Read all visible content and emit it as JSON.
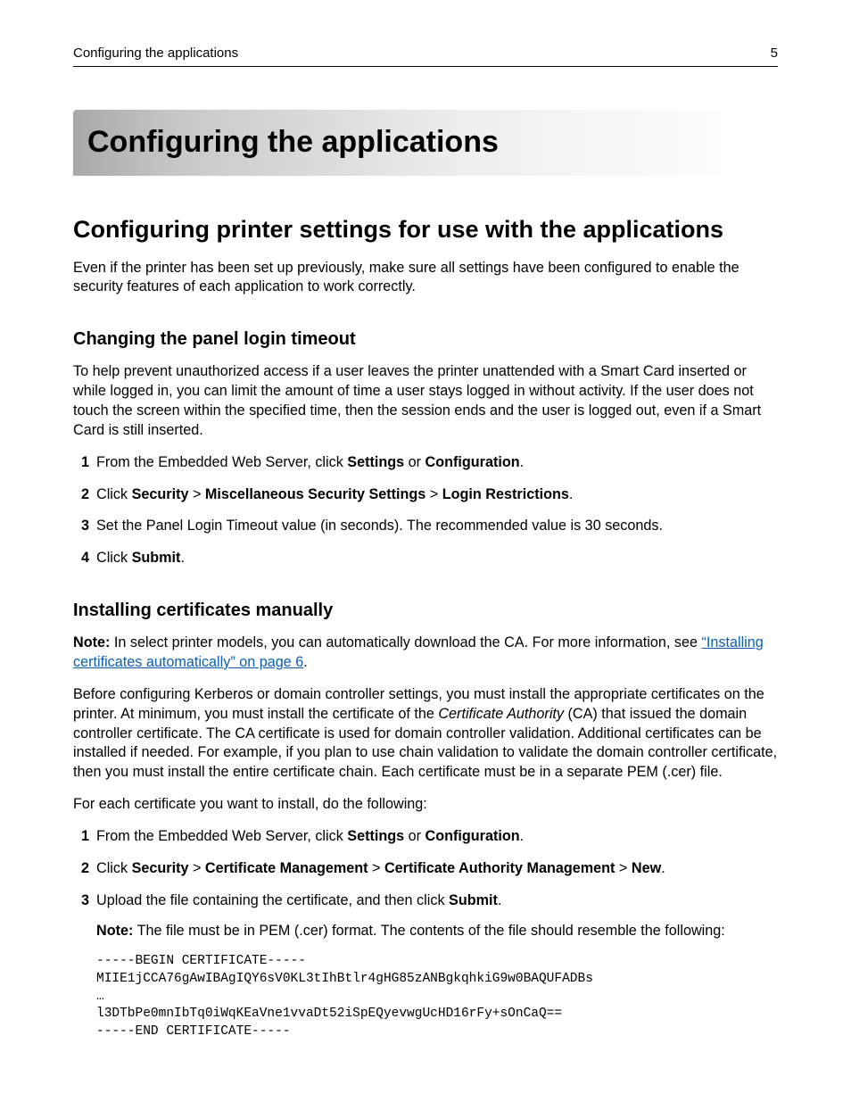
{
  "header": {
    "left": "Configuring the applications",
    "right": "5"
  },
  "chapter_title": "Configuring the applications",
  "section_title": "Configuring printer settings for use with the applications",
  "section_intro": "Even if the printer has been set up previously, make sure all settings have been configured to enable the security features of each application to work correctly.",
  "sub1": {
    "title": "Changing the panel login timeout",
    "intro": "To help prevent unauthorized access if a user leaves the printer unattended with a Smart Card inserted or while logged in, you can limit the amount of time a user stays logged in without activity. If the user does not touch the screen within the specified time, then the session ends and the user is logged out, even if a Smart Card is still inserted.",
    "steps": {
      "s1_pre": "From the Embedded Web Server, click ",
      "s1_b1": "Settings",
      "s1_mid": " or ",
      "s1_b2": "Configuration",
      "s1_post": ".",
      "s2_pre": "Click ",
      "s2_b1": "Security",
      "s2_sep1": " > ",
      "s2_b2": "Miscellaneous Security Settings",
      "s2_sep2": " > ",
      "s2_b3": "Login Restrictions",
      "s2_post": ".",
      "s3": "Set the Panel Login Timeout value (in seconds). The recommended value is 30 seconds.",
      "s4_pre": "Click ",
      "s4_b1": "Submit",
      "s4_post": "."
    }
  },
  "sub2": {
    "title": "Installing certificates manually",
    "note_label": "Note:",
    "note_text_pre": " In select printer models, you can automatically download the CA. For more information, see ",
    "note_link": "“Installing certificates automatically” on page 6",
    "note_text_post": ".",
    "para2_pre": "Before configuring Kerberos or domain controller settings, you must install the appropriate certificates on the printer. At minimum, you must install the certificate of the ",
    "para2_i": "Certificate Authority",
    "para2_post": " (CA) that issued the domain controller certificate. The CA certificate is used for domain controller validation. Additional certificates can be installed if needed. For example, if you plan to use chain validation to validate the domain controller certificate, then you must install the entire certificate chain. Each certificate must be in a separate PEM (.cer) file.",
    "para3": "For each certificate you want to install, do the following:",
    "steps": {
      "s1_pre": "From the Embedded Web Server, click ",
      "s1_b1": "Settings",
      "s1_mid": " or ",
      "s1_b2": "Configuration",
      "s1_post": ".",
      "s2_pre": "Click ",
      "s2_b1": "Security",
      "s2_sep1": " > ",
      "s2_b2": "Certificate Management",
      "s2_sep2": " > ",
      "s2_b3": "Certificate Authority Management",
      "s2_sep3": " > ",
      "s2_b4": "New",
      "s2_post": ".",
      "s3_pre": "Upload the file containing the certificate, and then click ",
      "s3_b1": "Submit",
      "s3_post": ".",
      "s3_note_label": "Note:",
      "s3_note_text": " The file must be in PEM (.cer) format. The contents of the file should resemble the following:"
    },
    "cert_block": "-----BEGIN CERTIFICATE-----\nMIIE1jCCA76gAwIBAgIQY6sV0KL3tIhBtlr4gHG85zANBgkqhkiG9w0BAQUFADBs\n…\nl3DTbPe0mnIbTq0iWqKEaVne1vvaDt52iSpEQyevwgUcHD16rFy+sOnCaQ==\n-----END CERTIFICATE-----"
  }
}
